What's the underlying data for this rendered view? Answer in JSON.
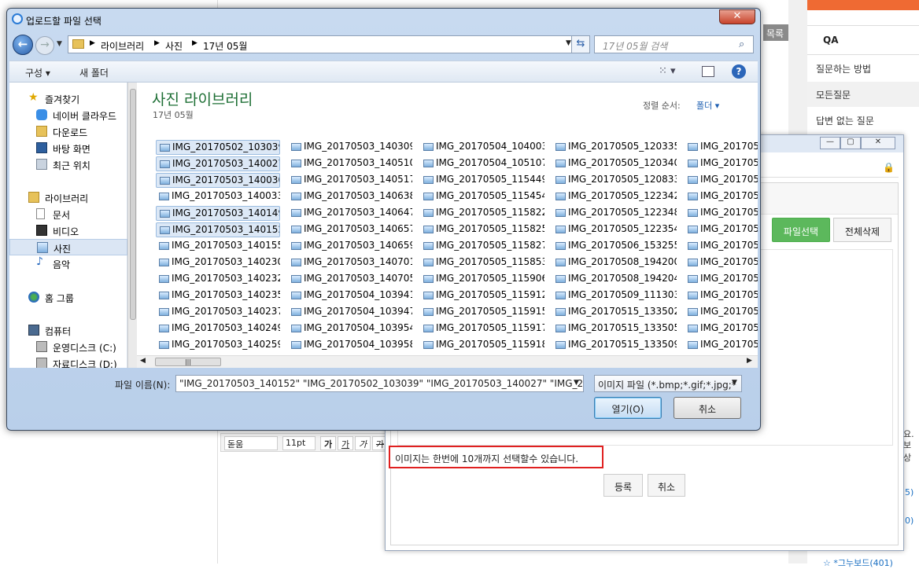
{
  "background": {
    "list_button": "목록",
    "qa_header": "QA",
    "qa_links": [
      "질문하는 방법",
      "모든질문",
      "답변 없는 질문"
    ],
    "editor_font": "돋움",
    "editor_size": "11pt",
    "editor_buttons": [
      "가",
      "가",
      "가",
      "가"
    ],
    "side_fragments": [
      "요.",
      "보상",
      "5)",
      "0)",
      "☆ *그누보드(401)"
    ]
  },
  "popup": {
    "file_select_button": "파일선택",
    "delete_all_button": "전체삭제",
    "notice": "이미지는 한번에 10개까지 선택할수 있습니다.",
    "register_button": "등록",
    "cancel_button": "취소"
  },
  "dialog": {
    "title": "업로드할 파일 선택",
    "close": "✕",
    "breadcrumb": [
      "라이브러리",
      "사진",
      "17년 05월"
    ],
    "search_placeholder": "17년 05월 검색",
    "toolbar": {
      "organize": "구성 ▾",
      "new_folder": "새 폴더"
    },
    "nav": {
      "favorites": "즐겨찾기",
      "cloud": "네이버 클라우드",
      "downloads": "다운로드",
      "desktop": "바탕 화면",
      "recent": "최근 위치",
      "libraries": "라이브러리",
      "documents": "문서",
      "videos": "비디오",
      "pictures": "사진",
      "music": "음악",
      "homegroup": "홈 그룹",
      "computer": "컴퓨터",
      "drive_c": "운영디스크 (C:)",
      "drive_d": "자료디스크 (D:)"
    },
    "library_title": "사진 라이브러리",
    "library_subtitle": "17년 05월",
    "sort_label": "정렬 순서:",
    "sort_value": "폴더 ▾",
    "files": [
      [
        "IMG_20170502_103039",
        "IMG_20170503_140027",
        "IMG_20170503_140030",
        "IMG_20170503_140033",
        "IMG_20170503_140149",
        "IMG_20170503_140152",
        "IMG_20170503_140155",
        "IMG_20170503_140230",
        "IMG_20170503_140232",
        "IMG_20170503_140235",
        "IMG_20170503_140237",
        "IMG_20170503_140249",
        "IMG_20170503_140259"
      ],
      [
        "IMG_20170503_140309",
        "IMG_20170503_140510",
        "IMG_20170503_140517",
        "IMG_20170503_140638",
        "IMG_20170503_140647",
        "IMG_20170503_140657",
        "IMG_20170503_140659",
        "IMG_20170503_140701",
        "IMG_20170503_140705",
        "IMG_20170504_103941",
        "IMG_20170504_103947",
        "IMG_20170504_103954",
        "IMG_20170504_103958"
      ],
      [
        "IMG_20170504_104003",
        "IMG_20170504_105107",
        "IMG_20170505_115449",
        "IMG_20170505_115454",
        "IMG_20170505_115822",
        "IMG_20170505_115825",
        "IMG_20170505_115827",
        "IMG_20170505_115853",
        "IMG_20170505_115906",
        "IMG_20170505_115912",
        "IMG_20170505_115915",
        "IMG_20170505_115917",
        "IMG_20170505_115918"
      ],
      [
        "IMG_20170505_120335",
        "IMG_20170505_120340",
        "IMG_20170505_120833",
        "IMG_20170505_122342",
        "IMG_20170505_122348",
        "IMG_20170505_122354",
        "IMG_20170506_153255",
        "IMG_20170508_194200",
        "IMG_20170508_194204",
        "IMG_20170509_111303",
        "IMG_20170515_133502",
        "IMG_20170515_133505",
        "IMG_20170515_133509"
      ],
      [
        "IMG_201705",
        "IMG_201705",
        "IMG_201705",
        "IMG_201705",
        "IMG_201705",
        "IMG_201705",
        "IMG_201705",
        "IMG_201705",
        "IMG_201705",
        "IMG_201705",
        "IMG_201705",
        "IMG_201705",
        "IMG_201705"
      ]
    ],
    "selected_files": [
      "IMG_20170502_103039",
      "IMG_20170503_140027",
      "IMG_20170503_140030",
      "IMG_20170503_140149",
      "IMG_20170503_140152"
    ],
    "filename_label": "파일 이름(N):",
    "filename_value": "\"IMG_20170503_140152\" \"IMG_20170502_103039\" \"IMG_20170503_140027\" \"IMG_2017C",
    "filetype_value": "이미지 파일 (*.bmp;*.gif;*.jpg;*",
    "open_button": "열기(O)",
    "cancel_button": "취소"
  }
}
